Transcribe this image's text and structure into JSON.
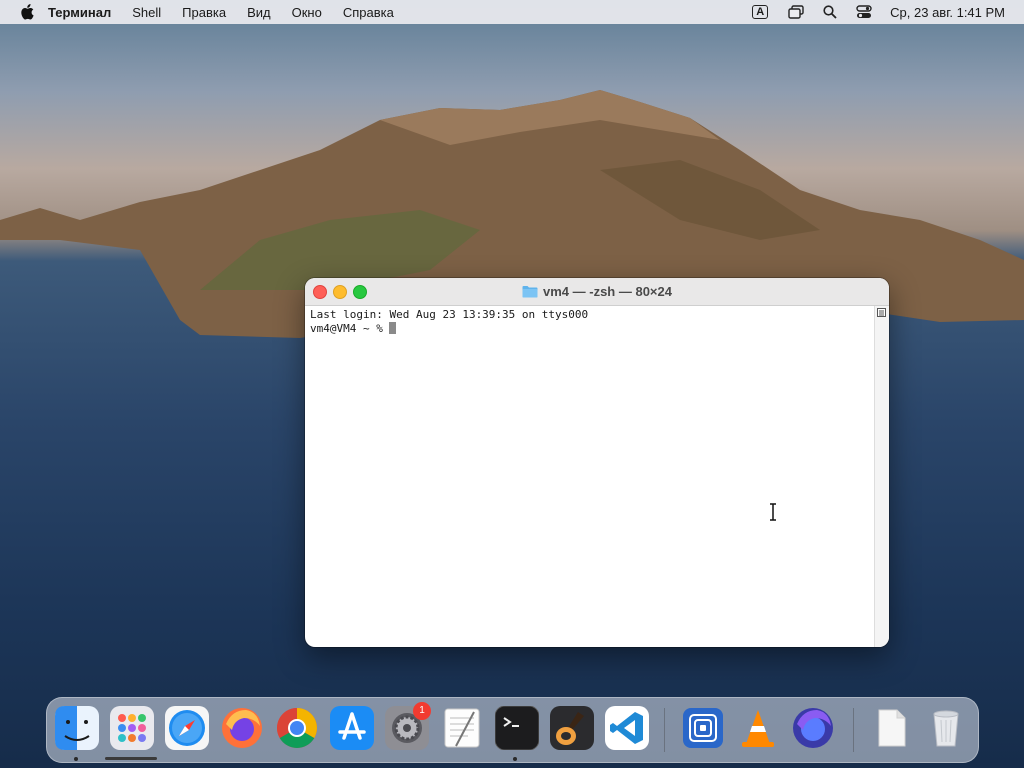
{
  "menubar": {
    "app_name": "Терминал",
    "menus": [
      "Shell",
      "Правка",
      "Вид",
      "Окно",
      "Справка"
    ],
    "input_source": "A",
    "clock": "Ср, 23 авг.  1:41 PM"
  },
  "window": {
    "title": "vm4 — -zsh — 80×24",
    "lines": [
      "Last login: Wed Aug 23 13:39:35 on ttys000",
      "vm4@VM4 ~ % "
    ]
  },
  "dock": {
    "items": [
      {
        "name": "Finder",
        "color": "#2f8cf0"
      },
      {
        "name": "Launchpad",
        "color": "#e8e8ec"
      },
      {
        "name": "Safari",
        "color": "#1f8cf0"
      },
      {
        "name": "Firefox",
        "color": "#ff7139"
      },
      {
        "name": "Chrome",
        "color": "#ffffff"
      },
      {
        "name": "App Store",
        "color": "#1b8cf5"
      },
      {
        "name": "System Preferences",
        "color": "#7d7d85"
      },
      {
        "name": "TextEdit",
        "color": "#f4f4f4"
      },
      {
        "name": "Terminal",
        "color": "#1e1e1e"
      },
      {
        "name": "GarageBand",
        "color": "#3a2a1e"
      },
      {
        "name": "Visual Studio Code",
        "color": "#ffffff"
      },
      {
        "name": "Folder",
        "color": "#2a67c9"
      },
      {
        "name": "VLC",
        "color": "#ff8800"
      },
      {
        "name": "Firefox Developer",
        "color": "#3a3aa8"
      },
      {
        "name": "Documents",
        "color": "#f6f6f6"
      },
      {
        "name": "Trash",
        "color": "#e6e8ec"
      }
    ],
    "system_prefs_badge": "1"
  }
}
